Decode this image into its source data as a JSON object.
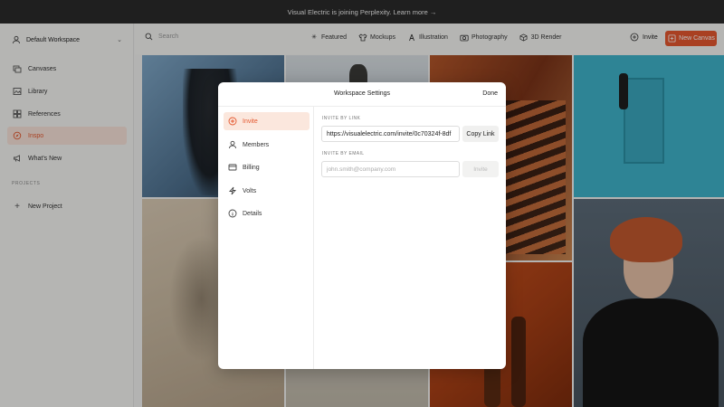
{
  "banner": {
    "text": "Visual Electric is joining Perplexity. Learn more →"
  },
  "sidebar": {
    "workspace": "Default Workspace",
    "items": [
      {
        "label": "Canvases",
        "icon": "canvases-icon"
      },
      {
        "label": "Library",
        "icon": "library-icon"
      },
      {
        "label": "References",
        "icon": "references-icon"
      },
      {
        "label": "Inspo",
        "icon": "inspo-icon",
        "active": true
      },
      {
        "label": "What's New",
        "icon": "megaphone-icon"
      }
    ],
    "projects_label": "PROJECTS",
    "new_project": "New Project"
  },
  "topbar": {
    "search_placeholder": "Search",
    "categories": [
      "Featured",
      "Mockups",
      "Illustration",
      "Photography",
      "3D Render"
    ],
    "invite": "Invite",
    "new_canvas": "New Canvas"
  },
  "modal": {
    "title": "Workspace Settings",
    "done": "Done",
    "nav": [
      {
        "label": "Invite",
        "icon": "add-user-icon",
        "active": true
      },
      {
        "label": "Members",
        "icon": "members-icon"
      },
      {
        "label": "Billing",
        "icon": "billing-icon"
      },
      {
        "label": "Volts",
        "icon": "volts-icon"
      },
      {
        "label": "Details",
        "icon": "info-icon"
      }
    ],
    "invite_by_link_label": "INVITE BY LINK",
    "invite_link": "https://visualelectric.com/invite/0c70324f-8df",
    "copy_link": "Copy Link",
    "invite_by_email_label": "INVITE BY EMAIL",
    "email_placeholder": "john.smith@company.com",
    "invite_button": "Invite"
  },
  "colors": {
    "accent": "#e4572e",
    "banner": "#2b2b2b"
  }
}
